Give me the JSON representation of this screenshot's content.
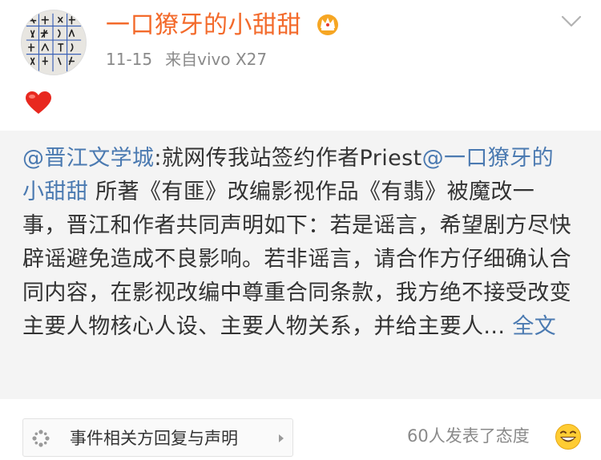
{
  "post": {
    "username": "一口獠牙的小甜甜",
    "date": "11-15",
    "source": "来自vivo X27"
  },
  "repost": {
    "mention1": "@晋江文学城",
    "text1": ":就网传我站签约作者Priest",
    "mention2": "@一口獠牙的小甜甜",
    "text2": " 所著《有匪》改编影视作品《有翡》被魔改一事，晋江和作者共同声明如下：若是谣言，希望剧方尽快辟谣避免造成不良影响。若非谣言，请合作方仔细确认合同内容，在影视改编中尊重合同条款，我方绝不接受改变主要人物核心人设、主要人物关系，并给主要人...",
    "full_text_link": "全文"
  },
  "footer": {
    "chip_label": "事件相关方回复与声明",
    "reactions": "60人发表了态度"
  },
  "colors": {
    "username": "#f36a2b",
    "link": "#4b7ab1",
    "repost_bg": "#f4f4f4",
    "meta": "#8a8a8a"
  },
  "icons": [
    "avatar",
    "vip-crown-icon",
    "chevron-down-icon",
    "heart-icon",
    "sparkle-icon",
    "chevron-right-icon",
    "grin-emoji-icon"
  ]
}
